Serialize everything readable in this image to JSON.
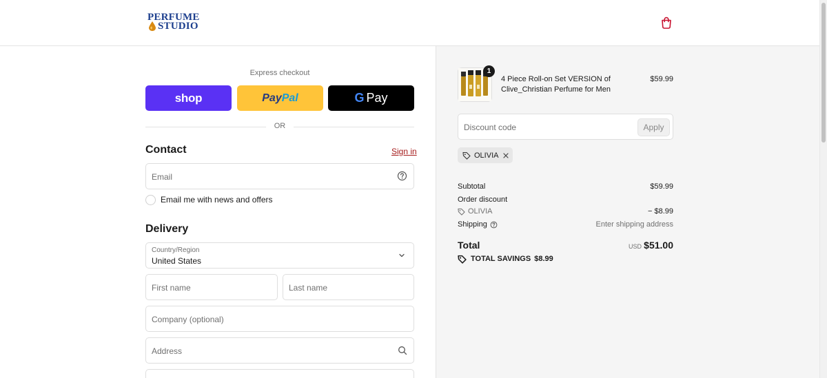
{
  "header": {
    "logo_line1": "PERFUME",
    "logo_line2": "STUDIO"
  },
  "express": {
    "label": "Express checkout",
    "shop_label": "shop",
    "paypal_part1": "Pay",
    "paypal_part2": "Pal",
    "gpay_g": "G",
    "gpay_label": "Pay",
    "or_label": "OR"
  },
  "contact": {
    "title": "Contact",
    "signin_label": "Sign in",
    "email_placeholder": "Email",
    "newsletter_label": "Email me with news and offers"
  },
  "delivery": {
    "title": "Delivery",
    "country_label": "Country/Region",
    "country_value": "United States",
    "first_name_placeholder": "First name",
    "last_name_placeholder": "Last name",
    "company_placeholder": "Company (optional)",
    "address_placeholder": "Address"
  },
  "summary": {
    "product_name": "4 Piece Roll-on Set VERSION of Clive_Christian Perfume for Men",
    "product_price": "$59.99",
    "quantity": "1",
    "discount_placeholder": "Discount code",
    "apply_label": "Apply",
    "applied_code": "OLIVIA",
    "subtotal_label": "Subtotal",
    "subtotal_value": "$59.99",
    "order_discount_label": "Order discount",
    "discount_code": "OLIVIA",
    "discount_value": "− $8.99",
    "shipping_label": "Shipping",
    "shipping_value": "Enter shipping address",
    "total_label": "Total",
    "currency": "USD",
    "total_value": "$51.00",
    "savings_label": "TOTAL SAVINGS",
    "savings_value": "$8.99"
  },
  "colors": {
    "shop_purple": "#5a31f4",
    "paypal_yellow": "#ffc439",
    "gpay_black": "#000000",
    "link_red": "#a51b1b",
    "logo_blue": "#1d3f8e"
  }
}
